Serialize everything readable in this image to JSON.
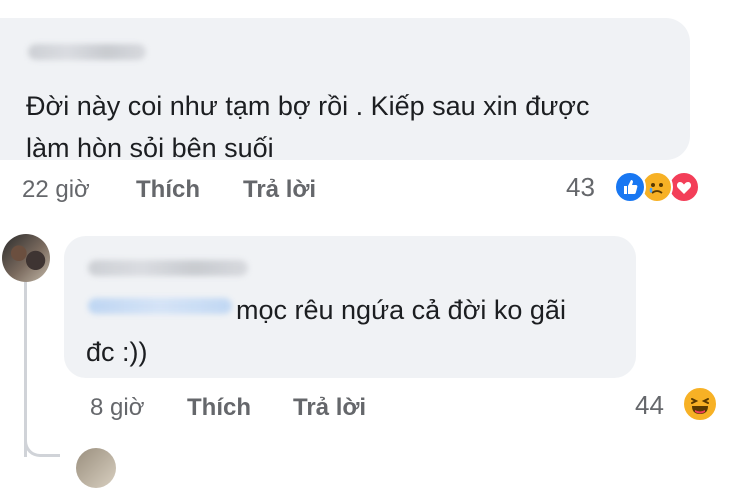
{
  "comment1": {
    "text_line1": "Đời này coi như tạm bợ rồi . Kiếp sau xin được",
    "text_line2": "làm hòn sỏi bên suối",
    "time": "22 giờ",
    "like_label": "Thích",
    "reply_label": "Trả lời",
    "reaction_count": "43",
    "reactions": [
      "like-icon",
      "sad-icon",
      "love-icon"
    ]
  },
  "comment2": {
    "text_line1": "mọc rêu ngứa cả đời ko gãi",
    "text_line2": "đc :))",
    "time": "8 giờ",
    "like_label": "Thích",
    "reply_label": "Trả lời",
    "reaction_count": "44",
    "reactions": [
      "haha-icon"
    ]
  },
  "colors": {
    "bubble": "#f0f2f5",
    "meta_text": "#65676b",
    "like_blue": "#1877f2",
    "love_red": "#f33e58",
    "emoji_yellow": "#f7b125"
  }
}
